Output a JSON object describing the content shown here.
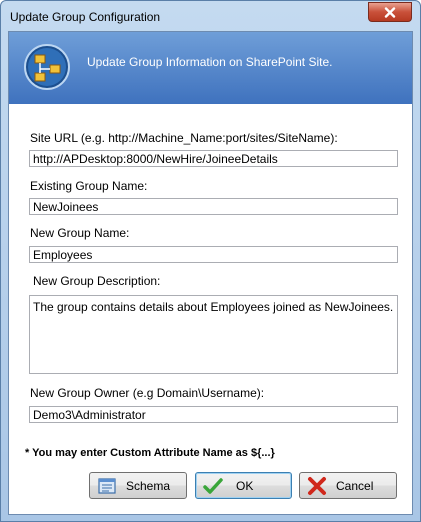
{
  "window": {
    "title": "Update Group Configuration"
  },
  "header": {
    "text": "Update Group Information on SharePoint Site."
  },
  "form": {
    "site_url_label": "Site URL (e.g. http://Machine_Name:port/sites/SiteName):",
    "site_url_value": "http://APDesktop:8000/NewHire/JoineeDetails",
    "existing_group_label": "Existing Group Name:",
    "existing_group_value": "NewJoinees",
    "new_group_label": "New Group Name:",
    "new_group_value": "Employees",
    "description_label": "New Group Description:",
    "description_value": "The group contains details about Employees joined as NewJoinees.",
    "owner_label": "New Group Owner (e.g Domain\\Username):",
    "owner_value": "Demo3\\Administrator",
    "note": "* You may enter Custom Attribute Name as ${...}"
  },
  "buttons": {
    "schema": "Schema",
    "ok": "OK",
    "cancel": "Cancel"
  },
  "icons": {
    "close": "close-icon",
    "header": "group-config-icon",
    "schema": "schema-icon",
    "ok": "checkmark-icon",
    "cancel": "cancel-x-icon"
  },
  "colors": {
    "header_band": "#4a7fc8",
    "ok_check": "#3aa63a",
    "cancel_x": "#d0281c"
  }
}
